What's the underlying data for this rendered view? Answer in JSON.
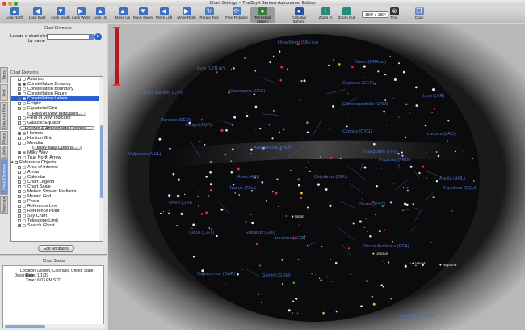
{
  "window": {
    "title": "Chart Settings – TheSkyX Serious Astronomer Edition"
  },
  "toolbar": {
    "buttons": [
      {
        "label": "Look North",
        "icon": "arrow-up-icon",
        "color": "#3d6fc4"
      },
      {
        "label": "Look East",
        "icon": "arrow-left-icon",
        "color": "#3d6fc4"
      },
      {
        "label": "Look South",
        "icon": "arrow-down-icon",
        "color": "#3d6fc4"
      },
      {
        "label": "Look West",
        "icon": "arrow-right-icon",
        "color": "#3d6fc4"
      },
      {
        "label": "Look Up",
        "icon": "arrow-up-icon",
        "color": "#3d6fc4"
      },
      {
        "label": "Move Up",
        "icon": "arrow-up-icon",
        "color": "#3d6fc4"
      },
      {
        "label": "Move Down",
        "icon": "arrow-down-icon",
        "color": "#3d6fc4"
      },
      {
        "label": "Move Left",
        "icon": "arrow-left-icon",
        "color": "#3d6fc4"
      },
      {
        "label": "Move Right",
        "icon": "arrow-right-icon",
        "color": "#3d6fc4"
      },
      {
        "label": "Rotate Tool",
        "icon": "rotate-icon",
        "color": "#4d7ac8"
      },
      {
        "label": "Free Rotation",
        "icon": "free-rotate-icon",
        "color": "#4d7ac8"
      },
      {
        "label": "Terrestrial Sphere",
        "icon": "terrestrial-sphere-icon",
        "color": "#3a7a3a"
      },
      {
        "label": "Celestial Sphere",
        "icon": "celestial-sphere-icon",
        "color": "#2a4f9e"
      },
      {
        "label": "Zoom In",
        "icon": "zoom-in-icon",
        "color": "#2a8a7a"
      },
      {
        "label": "Zoom Out",
        "icon": "zoom-out-icon",
        "color": "#2a8a7a"
      },
      {
        "label": "Find",
        "icon": "binoculars-icon",
        "color": "#333333"
      },
      {
        "label": "Copy",
        "icon": "copy-icon",
        "color": "#6b86c4"
      }
    ],
    "fov_select": "180° x 180°"
  },
  "sidebar": {
    "title": "Chart Elements",
    "locate_label": "Locate a chart element",
    "by_name_label": "by name",
    "search_value": "",
    "tabs": [
      "Telescope",
      "Chart Elements",
      "Labels",
      "Photos",
      "Date And Time",
      "Find",
      "Tours"
    ],
    "active_tab": "Chart Elements",
    "list_header": "Chart Elements",
    "items": [
      {
        "label": "Asterism",
        "checked": false,
        "swatch": "#ffffff"
      },
      {
        "label": "Constellation Drawing",
        "checked": true,
        "swatch": "#3a3a6a"
      },
      {
        "label": "Constellation Boundary",
        "checked": false,
        "swatch": "#ffffff"
      },
      {
        "label": "Constellation Figure",
        "checked": true,
        "swatch": "#ffffff"
      },
      {
        "label": "Constellation Labels",
        "checked": true,
        "swatch": "#ffffff",
        "highlight": true
      },
      {
        "label": "Ecliptic",
        "checked": false,
        "swatch": "#ffffff"
      },
      {
        "label": "Equatorial Grid",
        "checked": false,
        "swatch": "#ffffff"
      },
      {
        "label": "Field of View Indicators...",
        "button": true
      },
      {
        "label": "Field of View Indicator",
        "checked": false,
        "swatch": "#ffffff"
      },
      {
        "label": "Galactic Equator",
        "checked": false,
        "swatch": "#ffffff"
      },
      {
        "label": "Horizon & Atmosphere Options...",
        "button": true
      },
      {
        "label": "Horizon",
        "checked": true,
        "swatch": "#7a8cc0"
      },
      {
        "label": "Horizon Grid",
        "checked": false,
        "swatch": "#ffffff"
      },
      {
        "label": "Meridian",
        "checked": false,
        "swatch": "#ffffff"
      },
      {
        "label": "Milky Way Options...",
        "button": true
      },
      {
        "label": "Milky Way",
        "checked": true,
        "swatch": "#7a8cc0"
      },
      {
        "label": "True North Arrow",
        "checked": false,
        "swatch": "#ffffff"
      },
      {
        "label": "Reference Objects",
        "group": true
      },
      {
        "label": "Area of Interest",
        "checked": false,
        "swatch": "#ffffff"
      },
      {
        "label": "Arrow",
        "checked": false,
        "swatch": "#ffffff"
      },
      {
        "label": "Calendar",
        "checked": false,
        "swatch": "#ffffff"
      },
      {
        "label": "Chart Legend",
        "checked": false,
        "swatch": "#ffffff"
      },
      {
        "label": "Chart Scale",
        "checked": false,
        "swatch": "#ffffff"
      },
      {
        "label": "Meteor Shower Radiants",
        "checked": false,
        "swatch": "#ffffff"
      },
      {
        "label": "Mosaic Grid",
        "checked": false,
        "swatch": "#ffffff"
      },
      {
        "label": "Photo",
        "checked": false,
        "swatch": "#ffffff"
      },
      {
        "label": "Reference Line",
        "checked": false,
        "swatch": "#ffffff"
      },
      {
        "label": "Reference Point",
        "checked": false,
        "swatch": "#ffffff"
      },
      {
        "label": "Sky Chart",
        "checked": false,
        "swatch": "#ffffff"
      },
      {
        "label": "Telescope Limit",
        "checked": false,
        "swatch": "#ffffff"
      },
      {
        "label": "Search Ghost",
        "checked": true,
        "swatch": "#ffffff"
      }
    ],
    "edit_button": "Edit Attributes",
    "status_title": "Chart Status",
    "status": {
      "location_label": "Location Description:",
      "location_value": "Golden, Colorado, United State",
      "date_label": "Date:",
      "date_value": "1/1/09",
      "time_label": "Time:",
      "time_value": "6:03 PM STD"
    }
  },
  "sky": {
    "labels": [
      "Ursa Minor (UMi nv)",
      "Lynx (LYN nr)",
      "Draco (DRA sd)",
      "Canes Venatici (CVn)",
      "Cassiopeia (CAS)",
      "Camelopardalis (CAM)",
      "Cepheus (CEP)",
      "Lyra (LYR)",
      "Auriga (AUR)",
      "Perseus (PER)",
      "Cygnus (CYG)",
      "Andromeda (AND)",
      "Triangulum (TRI)",
      "Lacerta (LAC)",
      "Pegasus (PEG)",
      "Vulpecula (VUL)",
      "Aries (ARI)",
      "Taurus (TAU)",
      "Orion (ORI)",
      "Delphinus (DEL)",
      "Pisces (PSC)",
      "Aquila (AQL)",
      "Equuleus (EQU)",
      "Cetus (CET)",
      "Eridanus (ERI)",
      "Aquarius (AQR)",
      "Pisces Austrinus (PSA)",
      "Capricornus (CAP)",
      "Gemini (GEM)",
      "Canis Minor (CMI)"
    ],
    "planets": [
      "Moon",
      "Uranus",
      "Venus",
      "Neptune"
    ]
  }
}
